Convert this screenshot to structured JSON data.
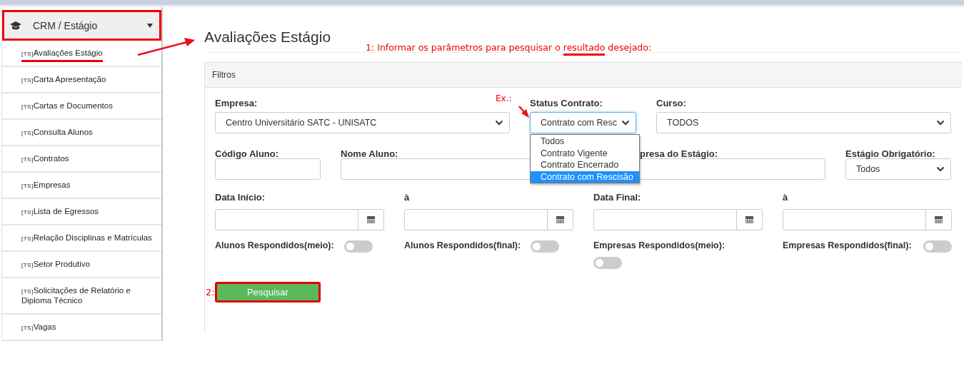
{
  "sidebar": {
    "header": {
      "label": "CRM / Estágio",
      "expanded": true,
      "highlighted": true
    },
    "items": [
      {
        "prefix": "[TS]",
        "label": "Avaliações Estágio",
        "underlined": true
      },
      {
        "prefix": "[TS]",
        "label": "Carta Apresentação",
        "underlined": false
      },
      {
        "prefix": "[TS]",
        "label": "Cartas e Documentos",
        "underlined": false
      },
      {
        "prefix": "[TS]",
        "label": "Consulta Alunos",
        "underlined": false
      },
      {
        "prefix": "[TS]",
        "label": "Contratos",
        "underlined": false
      },
      {
        "prefix": "[TS]",
        "label": "Empresas",
        "underlined": false
      },
      {
        "prefix": "[TS]",
        "label": "Lista de Egressos",
        "underlined": false
      },
      {
        "prefix": "[TS]",
        "label": "Relação Disciplinas e Matrículas",
        "underlined": false
      },
      {
        "prefix": "[TS]",
        "label": "Setor Produtivo",
        "underlined": false
      },
      {
        "prefix": "[TS]",
        "label": "Solicitações de Relatório e Diploma Técnico",
        "underlined": false
      },
      {
        "prefix": "[TS]",
        "label": "Vagas",
        "underlined": false
      }
    ]
  },
  "page": {
    "title": "Avaliações Estágio",
    "annotation": {
      "before": "1: Informar os parâmetros para pesquisar o",
      "highlight": "resultado",
      "after": "desejado:"
    },
    "panel": {
      "title": "Filtros",
      "rows": [
        [
          {
            "kind": "select",
            "label": "Empresa:",
            "value": "Centro Universitário SATC - UNISATC",
            "focused": false
          },
          {
            "kind": "select",
            "label": "Status Contrato:",
            "value": "Contrato com Resc",
            "note": "Ex.:",
            "focused": true,
            "options": [
              {
                "label": "Todos",
                "selected": false
              },
              {
                "label": "Contrato Vigente",
                "selected": false
              },
              {
                "label": "Contrato Encerrado",
                "selected": false
              },
              {
                "label": "Contrato com Rescisão",
                "selected": true
              }
            ]
          },
          {
            "kind": "select",
            "label": "Curso:",
            "value": "TODOS",
            "focused": false
          }
        ],
        [
          {
            "kind": "input",
            "label": "Código Aluno:"
          },
          {
            "kind": "input",
            "label": "Nome Aluno:"
          },
          {
            "kind": "input",
            "label": "presa do Estágio:"
          },
          {
            "kind": "select",
            "label": "Estágio Obrigatório:",
            "value": "Todos",
            "focused": false
          }
        ],
        [
          {
            "kind": "date",
            "label": "Data Início:"
          },
          {
            "kind": "date",
            "label": "à"
          },
          {
            "kind": "date",
            "label": "Data Final:"
          },
          {
            "kind": "date",
            "label": "à"
          }
        ],
        [
          {
            "kind": "switch",
            "label": "Alunos Respondidos(meio):",
            "on": false
          },
          {
            "kind": "switch",
            "label": "Alunos Respondidos(final):",
            "on": false
          },
          {
            "kind": "switch",
            "label": "Empresas Respondidos(meio):",
            "on": false
          },
          {
            "kind": "switch",
            "label": "Empresas Respondidos(final):",
            "on": false
          }
        ]
      ],
      "button": {
        "label": "Pesquisar",
        "note": "2:",
        "highlighted": true
      }
    }
  }
}
